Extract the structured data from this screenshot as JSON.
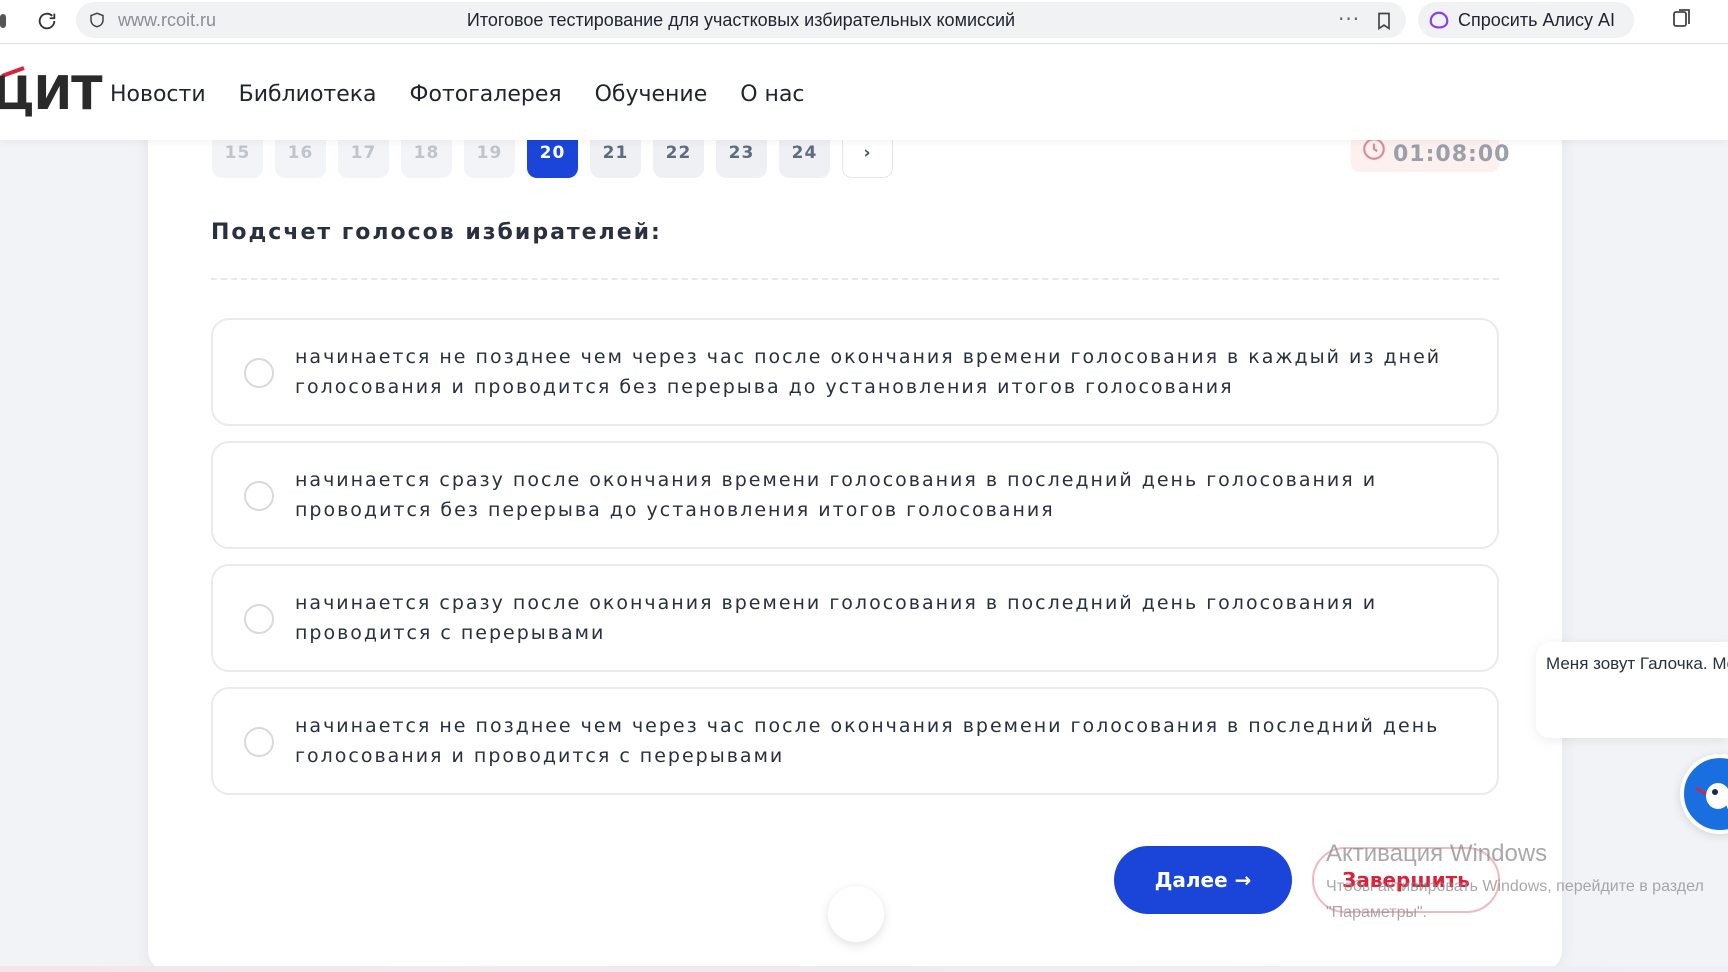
{
  "browser": {
    "url": "www.rcoit.ru",
    "tab_title": "Итоговое тестирование для участковых избирательных комиссий",
    "more_label": "···",
    "alice_label": "Спросить Алису AI"
  },
  "site": {
    "logo_text": "ЦИТ",
    "nav": [
      "Новости",
      "Библиотека",
      "Фотогалерея",
      "Обучение",
      "О нас"
    ]
  },
  "test": {
    "pages": [
      "15",
      "16",
      "17",
      "18",
      "19",
      "20",
      "21",
      "22",
      "23",
      "24"
    ],
    "current_page": "20",
    "next_page_label": "›",
    "timer": "01:08:00",
    "question": "Подсчет голосов избирателей:",
    "answers": [
      "начинается не позднее чем через час после окончания времени голосования в каждый из дней голосования и проводится без перерыва до установления итогов голосования",
      "начинается сразу после окончания времени голосования в последний день голосования и проводится без перерыва до установления итогов голосования",
      "начинается сразу после окончания времени голосования в последний день голосования и проводится с перерывами",
      "начинается не позднее чем через час после окончания времени голосования в последний день голосования и проводится с перерывами"
    ],
    "next_button": "Далее →",
    "finish_button": "Завершить"
  },
  "chat": {
    "message": "Меня зовут Галочка. Могу ли я Вам помочь?"
  },
  "watermark": {
    "title": "Активация Windows",
    "line1": "Чтобы активировать Windows, перейдите в раздел",
    "line2": "\"Параметры\"."
  },
  "colors": {
    "accent": "#1a45d8",
    "danger": "#d9233b",
    "timer_bg": "#fdf1f0"
  }
}
